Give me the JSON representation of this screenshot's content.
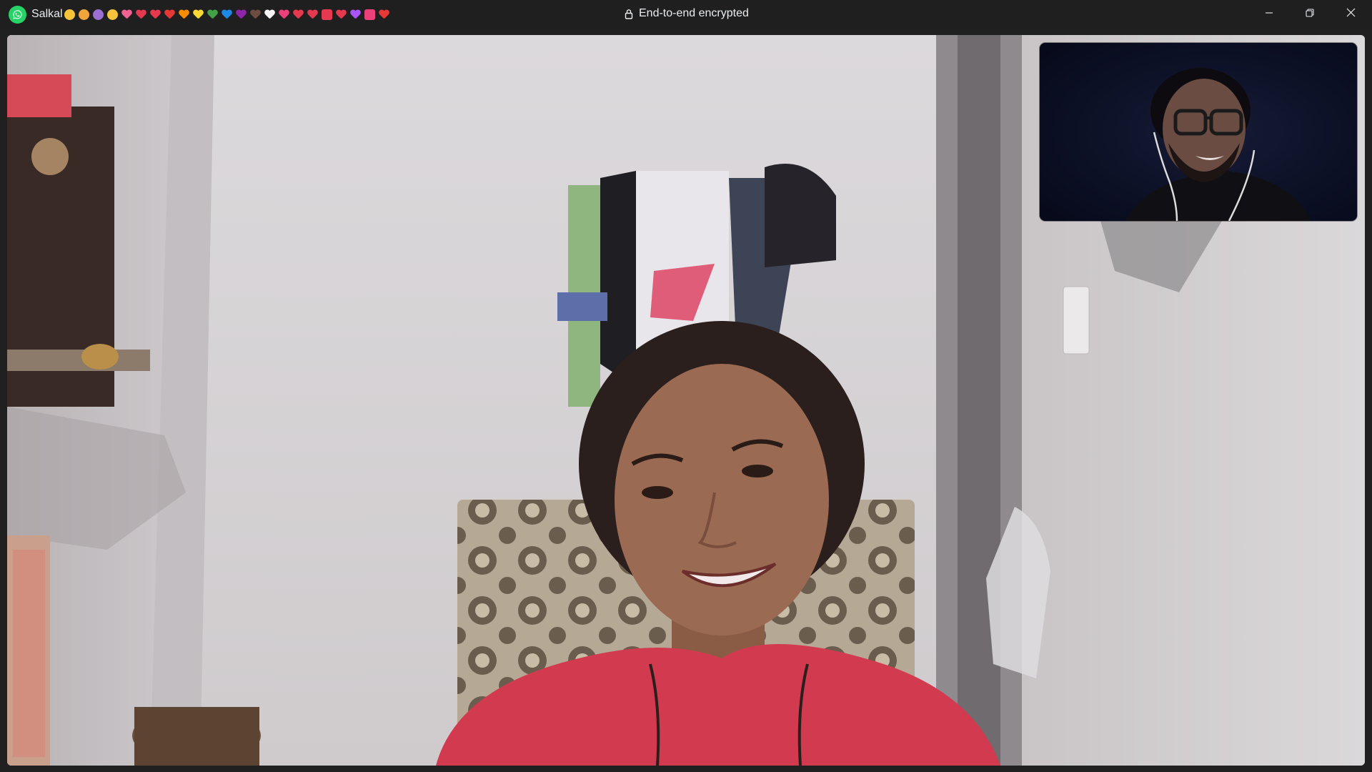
{
  "app": {
    "logo_icon": "whatsapp-logo-icon",
    "accent_color": "#25d366"
  },
  "titlebar": {
    "contact_name": "Salkal",
    "name_emojis": [
      {
        "icon": "smiling-face-icon",
        "color": "#f5c43a"
      },
      {
        "icon": "cat-face-icon",
        "color": "#f0a53a"
      },
      {
        "icon": "purple-face-icon",
        "color": "#9b6fd1"
      },
      {
        "icon": "smiling-face-icon",
        "color": "#f5c43a"
      },
      {
        "icon": "pink-heart-icon",
        "color": "#f06292"
      },
      {
        "icon": "heart-exclamation-icon",
        "color": "#e53950"
      },
      {
        "icon": "heart-exclamation-icon",
        "color": "#e53950"
      },
      {
        "icon": "red-heart-icon",
        "color": "#e53935"
      },
      {
        "icon": "orange-heart-icon",
        "color": "#fb8c00"
      },
      {
        "icon": "yellow-heart-icon",
        "color": "#fdd835"
      },
      {
        "icon": "green-heart-icon",
        "color": "#43a047"
      },
      {
        "icon": "blue-heart-icon",
        "color": "#1e88e5"
      },
      {
        "icon": "purple-heart-icon",
        "color": "#8e24aa"
      },
      {
        "icon": "brown-heart-icon",
        "color": "#6d4c41"
      },
      {
        "icon": "white-heart-icon",
        "color": "#f5f5f5"
      },
      {
        "icon": "heart-with-arrow-icon",
        "color": "#ec407a"
      },
      {
        "icon": "heart-with-ribbon-icon",
        "color": "#e53950"
      },
      {
        "icon": "heart-exclamation-icon",
        "color": "#e53950"
      },
      {
        "icon": "love-letter-icon",
        "color": "#e53950"
      },
      {
        "icon": "heart-exclamation-icon",
        "color": "#e53950"
      },
      {
        "icon": "heart-decoration-icon",
        "color": "#a855f7"
      },
      {
        "icon": "love-letter-icon",
        "color": "#ec407a"
      },
      {
        "icon": "red-heart-icon",
        "color": "#e53935"
      }
    ],
    "encryption_label": "End-to-end encrypted",
    "lock_icon": "lock-icon",
    "controls": {
      "minimize_icon": "minimize-icon",
      "restore_icon": "restore-icon",
      "close_icon": "close-icon"
    }
  },
  "call": {
    "remote_video": {
      "kind": "remote-participant-video"
    },
    "self_view": {
      "kind": "self-view-video"
    }
  }
}
